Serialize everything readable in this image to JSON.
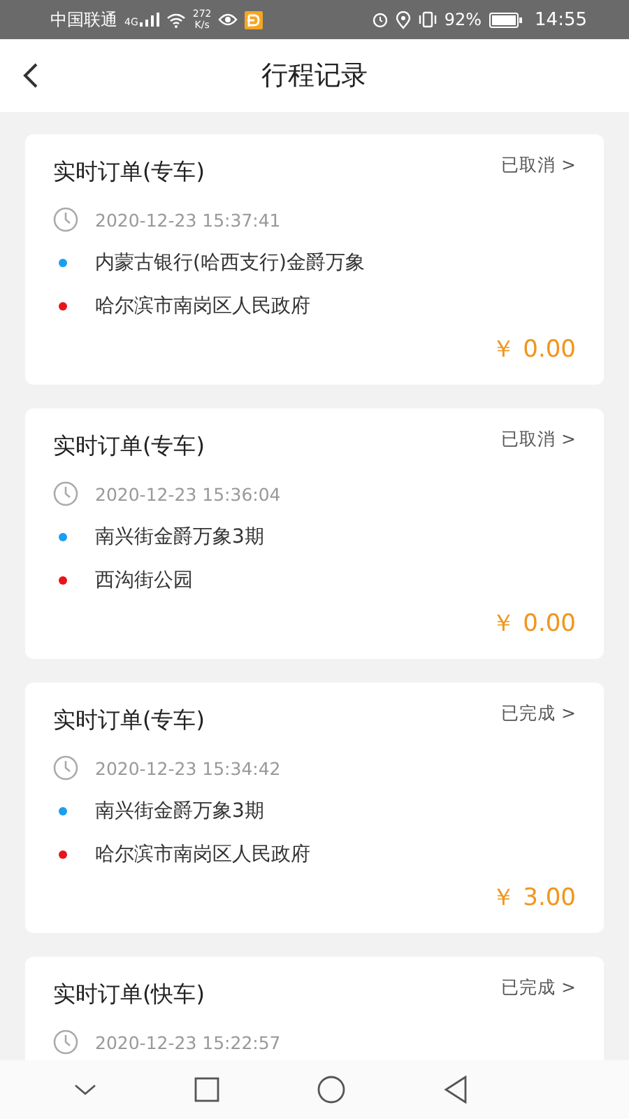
{
  "status_bar": {
    "carrier": "中国联通",
    "network": "4G",
    "speed": "272",
    "speed_unit": "K/s",
    "battery": "92%",
    "time": "14:55"
  },
  "header": {
    "title": "行程记录"
  },
  "orders": [
    {
      "title": "实时订单(专车)",
      "status": "已取消 >",
      "time": "2020-12-23 15:37:41",
      "stops": [
        {
          "name": "内蒙古银行(哈西支行)金爵万象",
          "color": "#1a9ff0"
        },
        {
          "name": "哈尔滨市南岗区人民政府",
          "color": "#e8141a"
        }
      ],
      "price": "￥ 0.00"
    },
    {
      "title": "实时订单(专车)",
      "status": "已取消 >",
      "time": "2020-12-23 15:36:04",
      "stops": [
        {
          "name": "南兴街金爵万象3期",
          "color": "#1a9ff0"
        },
        {
          "name": "西沟街公园",
          "color": "#e8141a"
        }
      ],
      "price": "￥ 0.00"
    },
    {
      "title": "实时订单(专车)",
      "status": "已完成 >",
      "time": "2020-12-23 15:34:42",
      "stops": [
        {
          "name": "南兴街金爵万象3期",
          "color": "#1a9ff0"
        },
        {
          "name": "哈尔滨市南岗区人民政府",
          "color": "#e8141a"
        }
      ],
      "price": "￥ 3.00"
    },
    {
      "title": "实时订单(快车)",
      "status": "已完成 >",
      "time": "2020-12-23 15:22:57"
    }
  ]
}
